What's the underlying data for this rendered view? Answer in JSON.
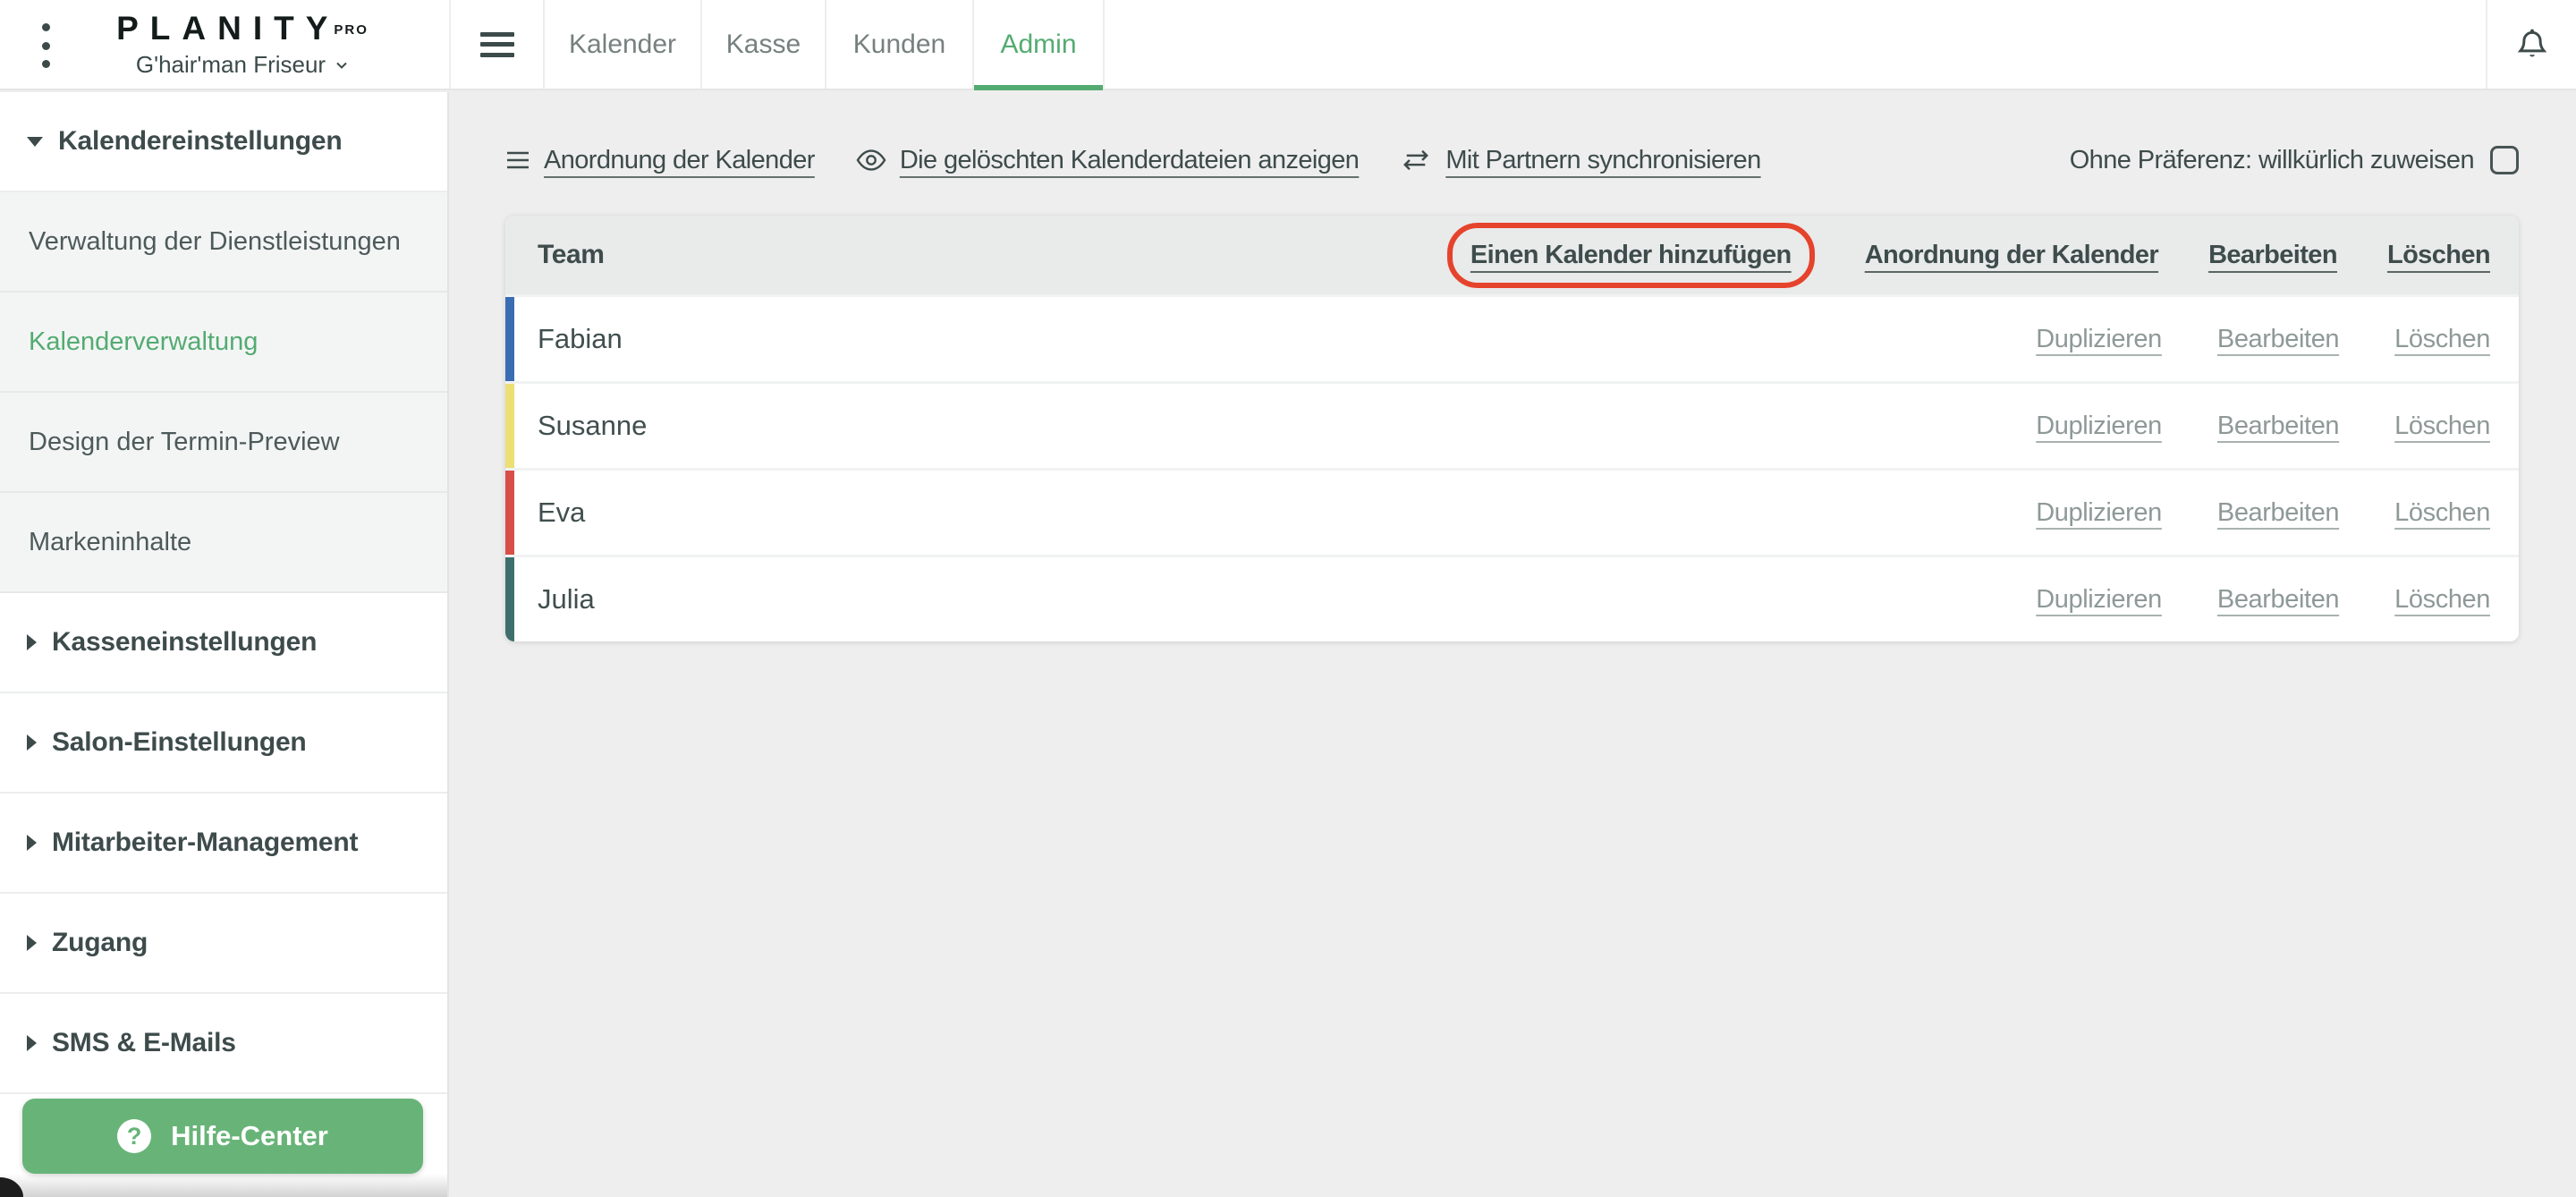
{
  "colors": {
    "accent_green": "#54ab71",
    "button_green": "#68b478",
    "annotation_red": "#e5432c"
  },
  "header": {
    "logo": "PLANITY",
    "logo_badge": "PRO",
    "account_name": "G'hair'man Friseur",
    "tabs": [
      {
        "label": "Kalender",
        "active": false
      },
      {
        "label": "Kasse",
        "active": false
      },
      {
        "label": "Kunden",
        "active": false
      },
      {
        "label": "Admin",
        "active": true
      }
    ]
  },
  "sidebar": {
    "items": [
      {
        "label": "Kalendereinstellungen",
        "kind": "group-expanded"
      },
      {
        "label": "Verwaltung der Dienstleistungen",
        "kind": "sub",
        "active": false
      },
      {
        "label": "Kalenderverwaltung",
        "kind": "sub",
        "active": true
      },
      {
        "label": "Design der Termin-Preview",
        "kind": "sub",
        "active": false
      },
      {
        "label": "Markeninhalte",
        "kind": "sub",
        "active": false
      },
      {
        "label": "Kasseneinstellungen",
        "kind": "group-collapsed"
      },
      {
        "label": "Salon-Einstellungen",
        "kind": "group-collapsed"
      },
      {
        "label": "Mitarbeiter-Management",
        "kind": "group-collapsed"
      },
      {
        "label": "Zugang",
        "kind": "group-collapsed"
      },
      {
        "label": "SMS & E-Mails",
        "kind": "group-collapsed"
      }
    ],
    "help_button": {
      "label": "Hilfe-Center"
    }
  },
  "toolbar": {
    "links": [
      {
        "icon": "list-icon",
        "label": "Anordnung der Kalender"
      },
      {
        "icon": "eye-icon",
        "label": "Die gelöschten Kalenderdateien anzeigen"
      },
      {
        "icon": "sync-icon",
        "label": "Mit Partnern synchronisieren"
      }
    ],
    "preference": {
      "label": "Ohne Präferenz: willkürlich zuweisen",
      "checked": false
    }
  },
  "table": {
    "title": "Team",
    "header_actions": [
      {
        "label": "Einen Kalender hinzufügen",
        "highlighted": true
      },
      {
        "label": "Anordnung der Kalender",
        "highlighted": false
      },
      {
        "label": "Bearbeiten",
        "highlighted": false
      },
      {
        "label": "Löschen",
        "highlighted": false
      }
    ],
    "rows": [
      {
        "name": "Fabian",
        "color": "#3a6cb3",
        "actions": [
          "Duplizieren",
          "Bearbeiten",
          "Löschen"
        ]
      },
      {
        "name": "Susanne",
        "color": "#ecdf74",
        "actions": [
          "Duplizieren",
          "Bearbeiten",
          "Löschen"
        ]
      },
      {
        "name": "Eva",
        "color": "#d84f48",
        "actions": [
          "Duplizieren",
          "Bearbeiten",
          "Löschen"
        ]
      },
      {
        "name": "Julia",
        "color": "#3e6f6c",
        "actions": [
          "Duplizieren",
          "Bearbeiten",
          "Löschen"
        ]
      }
    ]
  }
}
